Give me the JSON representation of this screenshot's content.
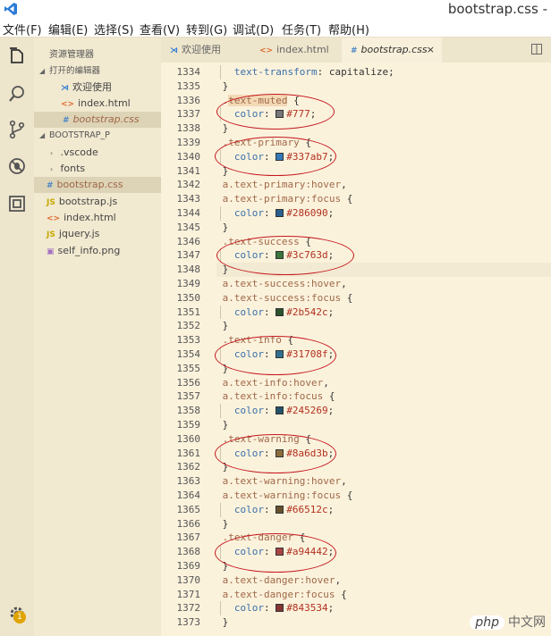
{
  "window": {
    "title": "bootstrap.css -"
  },
  "menu": [
    "文件(F)",
    "编辑(E)",
    "选择(S)",
    "查看(V)",
    "转到(G)",
    "调试(D)",
    "任务(T)",
    "帮助(H)"
  ],
  "activity": {
    "badge_count": "1"
  },
  "sidebar": {
    "title": "资源管理器",
    "open_editors_label": "打开的编辑器",
    "open_editors": [
      {
        "name": "欢迎使用",
        "icon": "vscode-logo-icon"
      },
      {
        "name": "index.html",
        "icon": "html-file-icon"
      },
      {
        "name": "bootstrap.css",
        "icon": "css-file-icon"
      }
    ],
    "project_label": "BOOTSTRAP_P",
    "folders": [
      ".vscode",
      "fonts"
    ],
    "files": [
      {
        "name": "bootstrap.css",
        "icon": "css-file-icon",
        "glyph": "#"
      },
      {
        "name": "bootstrap.js",
        "icon": "js-file-icon",
        "glyph": "JS"
      },
      {
        "name": "index.html",
        "icon": "html-file-icon",
        "glyph": "<>"
      },
      {
        "name": "jquery.js",
        "icon": "js-file-icon",
        "glyph": "JS"
      },
      {
        "name": "self_info.png",
        "icon": "image-file-icon",
        "glyph": "▣"
      }
    ]
  },
  "tabs": [
    {
      "label": "欢迎使用",
      "icon": "vscode-logo-icon"
    },
    {
      "label": "index.html",
      "icon": "html-file-icon",
      "glyph": "<>"
    },
    {
      "label": "bootstrap.css",
      "icon": "css-file-icon",
      "glyph": "#",
      "close": "×"
    }
  ],
  "editor": {
    "lines": [
      {
        "n": "1334",
        "parts": [
          [
            "  ",
            ""
          ],
          [
            "text-transform",
            "prop"
          ],
          [
            ": capitalize;",
            ""
          ]
        ]
      },
      {
        "n": "1335",
        "parts": [
          [
            "}",
            ""
          ]
        ]
      },
      {
        "n": "1336",
        "parts": [
          [
            ".",
            "sel"
          ],
          [
            "text-muted",
            "sel"
          ],
          [
            " {",
            ""
          ]
        ]
      },
      {
        "n": "1337",
        "parts": [
          [
            "  ",
            ""
          ],
          [
            "color",
            "prop"
          ],
          [
            ": ",
            ""
          ],
          [
            "#777",
            "val"
          ],
          [
            ";",
            ""
          ]
        ],
        "swatch": "#777777"
      },
      {
        "n": "1338",
        "parts": [
          [
            "}",
            ""
          ]
        ]
      },
      {
        "n": "1339",
        "parts": [
          [
            ".text-primary",
            "sel"
          ],
          [
            " {",
            ""
          ]
        ]
      },
      {
        "n": "1340",
        "parts": [
          [
            "  ",
            ""
          ],
          [
            "color",
            "prop"
          ],
          [
            ": ",
            ""
          ],
          [
            "#337ab7",
            "val"
          ],
          [
            ";",
            ""
          ]
        ],
        "swatch": "#337ab7"
      },
      {
        "n": "1341",
        "parts": [
          [
            "}",
            ""
          ]
        ]
      },
      {
        "n": "1342",
        "parts": [
          [
            "a.text-primary:hover",
            "sel"
          ],
          [
            ",",
            ""
          ]
        ]
      },
      {
        "n": "1343",
        "parts": [
          [
            "a.text-primary:focus",
            "sel"
          ],
          [
            " {",
            ""
          ]
        ]
      },
      {
        "n": "1344",
        "parts": [
          [
            "  ",
            ""
          ],
          [
            "color",
            "prop"
          ],
          [
            ": ",
            ""
          ],
          [
            "#286090",
            "val"
          ],
          [
            ";",
            ""
          ]
        ],
        "swatch": "#286090"
      },
      {
        "n": "1345",
        "parts": [
          [
            "}",
            ""
          ]
        ]
      },
      {
        "n": "1346",
        "parts": [
          [
            ".text-success",
            "sel"
          ],
          [
            " {",
            ""
          ]
        ]
      },
      {
        "n": "1347",
        "parts": [
          [
            "  ",
            ""
          ],
          [
            "color",
            "prop"
          ],
          [
            ": ",
            ""
          ],
          [
            "#3c763d",
            "val"
          ],
          [
            ";",
            ""
          ]
        ],
        "swatch": "#3c763d"
      },
      {
        "n": "1348",
        "parts": [
          [
            "}",
            ""
          ]
        ],
        "active": true
      },
      {
        "n": "1349",
        "parts": [
          [
            "a.text-success:hover",
            "sel"
          ],
          [
            ",",
            ""
          ]
        ]
      },
      {
        "n": "1350",
        "parts": [
          [
            "a.text-success:focus",
            "sel"
          ],
          [
            " {",
            ""
          ]
        ]
      },
      {
        "n": "1351",
        "parts": [
          [
            "  ",
            ""
          ],
          [
            "color",
            "prop"
          ],
          [
            ": ",
            ""
          ],
          [
            "#2b542c",
            "val"
          ],
          [
            ";",
            ""
          ]
        ],
        "swatch": "#2b542c"
      },
      {
        "n": "1352",
        "parts": [
          [
            "}",
            ""
          ]
        ]
      },
      {
        "n": "1353",
        "parts": [
          [
            ".text-info",
            "sel"
          ],
          [
            " {",
            ""
          ]
        ]
      },
      {
        "n": "1354",
        "parts": [
          [
            "  ",
            ""
          ],
          [
            "color",
            "prop"
          ],
          [
            ": ",
            ""
          ],
          [
            "#31708f",
            "val"
          ],
          [
            ";",
            ""
          ]
        ],
        "swatch": "#31708f"
      },
      {
        "n": "1355",
        "parts": [
          [
            "}",
            ""
          ]
        ]
      },
      {
        "n": "1356",
        "parts": [
          [
            "a.text-info:hover",
            "sel"
          ],
          [
            ",",
            ""
          ]
        ]
      },
      {
        "n": "1357",
        "parts": [
          [
            "a.text-info:focus",
            "sel"
          ],
          [
            " {",
            ""
          ]
        ]
      },
      {
        "n": "1358",
        "parts": [
          [
            "  ",
            ""
          ],
          [
            "color",
            "prop"
          ],
          [
            ": ",
            ""
          ],
          [
            "#245269",
            "val"
          ],
          [
            ";",
            ""
          ]
        ],
        "swatch": "#245269"
      },
      {
        "n": "1359",
        "parts": [
          [
            "}",
            ""
          ]
        ]
      },
      {
        "n": "1360",
        "parts": [
          [
            ".text-warning",
            "sel"
          ],
          [
            " {",
            ""
          ]
        ]
      },
      {
        "n": "1361",
        "parts": [
          [
            "  ",
            ""
          ],
          [
            "color",
            "prop"
          ],
          [
            ": ",
            ""
          ],
          [
            "#8a6d3b",
            "val"
          ],
          [
            ";",
            ""
          ]
        ],
        "swatch": "#8a6d3b"
      },
      {
        "n": "1362",
        "parts": [
          [
            "}",
            ""
          ]
        ]
      },
      {
        "n": "1363",
        "parts": [
          [
            "a.text-warning:hover",
            "sel"
          ],
          [
            ",",
            ""
          ]
        ]
      },
      {
        "n": "1364",
        "parts": [
          [
            "a.text-warning:focus",
            "sel"
          ],
          [
            " {",
            ""
          ]
        ]
      },
      {
        "n": "1365",
        "parts": [
          [
            "  ",
            ""
          ],
          [
            "color",
            "prop"
          ],
          [
            ": ",
            ""
          ],
          [
            "#66512c",
            "val"
          ],
          [
            ";",
            ""
          ]
        ],
        "swatch": "#66512c"
      },
      {
        "n": "1366",
        "parts": [
          [
            "}",
            ""
          ]
        ]
      },
      {
        "n": "1367",
        "parts": [
          [
            ".text-danger",
            "sel"
          ],
          [
            " {",
            ""
          ]
        ]
      },
      {
        "n": "1368",
        "parts": [
          [
            "  ",
            ""
          ],
          [
            "color",
            "prop"
          ],
          [
            ": ",
            ""
          ],
          [
            "#a94442",
            "val"
          ],
          [
            ";",
            ""
          ]
        ],
        "swatch": "#a94442"
      },
      {
        "n": "1369",
        "parts": [
          [
            "}",
            ""
          ]
        ]
      },
      {
        "n": "1370",
        "parts": [
          [
            "a.text-danger:hover",
            "sel"
          ],
          [
            ",",
            ""
          ]
        ]
      },
      {
        "n": "1371",
        "parts": [
          [
            "a.text-danger:focus",
            "sel"
          ],
          [
            " {",
            ""
          ]
        ]
      },
      {
        "n": "1372",
        "parts": [
          [
            "  ",
            ""
          ],
          [
            "color",
            "prop"
          ],
          [
            ": ",
            ""
          ],
          [
            "#843534",
            "val"
          ],
          [
            ";",
            ""
          ]
        ],
        "swatch": "#843534"
      },
      {
        "n": "1373",
        "parts": [
          [
            "}",
            ""
          ]
        ]
      }
    ]
  },
  "watermark": {
    "brand": "php",
    "site": "中文网"
  }
}
